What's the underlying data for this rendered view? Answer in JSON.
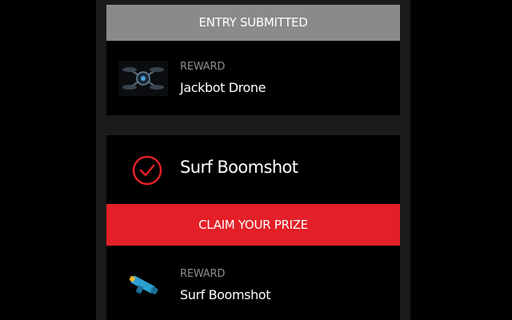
{
  "entries": [
    {
      "banner": "ENTRY SUBMITTED",
      "reward_label": "REWARD",
      "reward_name": "Jackbot Drone",
      "thumb_icon": "drone-icon"
    },
    {
      "title": "Surf Boomshot",
      "status_icon": "check-circle-icon",
      "cta": "CLAIM YOUR PRIZE",
      "reward_label": "REWARD",
      "reward_name": "Surf Boomshot",
      "thumb_icon": "blaster-icon"
    }
  ],
  "colors": {
    "accent": "#e32027",
    "submitted_banner": "#8a8a8a",
    "card": "#000000",
    "panel": "#1a1a1a",
    "label": "#8e8e8e"
  }
}
